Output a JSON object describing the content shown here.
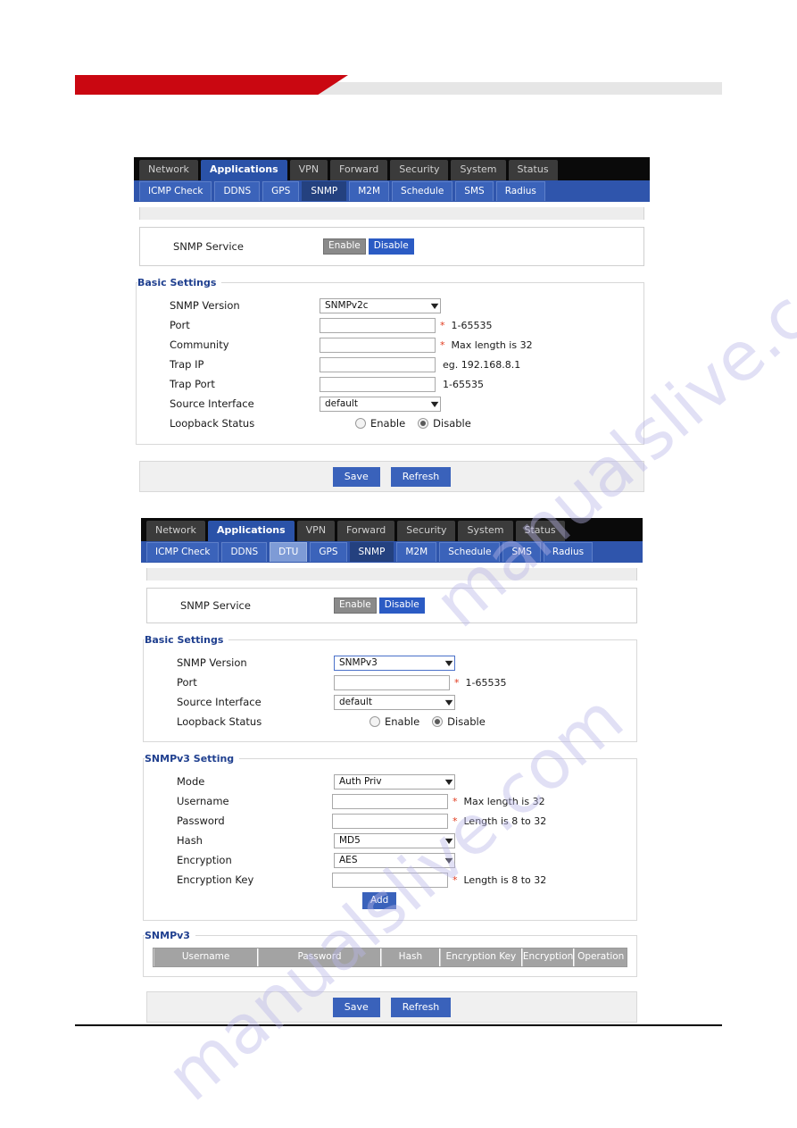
{
  "header": {
    "banner_red_color": "#ca0711",
    "banner_gray_color": "#e6e6e6"
  },
  "watermark": {
    "text_1": "manualslive.com",
    "text_2": "manualslive.com",
    "color": "#b9b6e8"
  },
  "panel1": {
    "main_tabs": [
      {
        "label": "Network",
        "active": false
      },
      {
        "label": "Applications",
        "active": true
      },
      {
        "label": "VPN",
        "active": false
      },
      {
        "label": "Forward",
        "active": false
      },
      {
        "label": "Security",
        "active": false
      },
      {
        "label": "System",
        "active": false
      },
      {
        "label": "Status",
        "active": false
      }
    ],
    "sub_tabs": [
      {
        "label": "ICMP Check",
        "state": "normal"
      },
      {
        "label": "DDNS",
        "state": "normal"
      },
      {
        "label": "GPS",
        "state": "normal"
      },
      {
        "label": "SNMP",
        "state": "active"
      },
      {
        "label": "M2M",
        "state": "normal"
      },
      {
        "label": "Schedule",
        "state": "normal"
      },
      {
        "label": "SMS",
        "state": "normal"
      },
      {
        "label": "Radius",
        "state": "normal"
      }
    ],
    "service": {
      "label": "SNMP Service",
      "enable_label": "Enable",
      "disable_label": "Disable",
      "selected": "Disable"
    },
    "basic_settings": {
      "legend": "Basic Settings",
      "rows": [
        {
          "label": "SNMP Version",
          "type": "select",
          "value": "SNMPv2c",
          "required": false,
          "hint": ""
        },
        {
          "label": "Port",
          "type": "text",
          "value": "",
          "required": true,
          "hint": "1-65535"
        },
        {
          "label": "Community",
          "type": "text",
          "value": "",
          "required": true,
          "hint": "Max length is 32"
        },
        {
          "label": "Trap IP",
          "type": "text",
          "value": "",
          "required": false,
          "hint": "eg. 192.168.8.1"
        },
        {
          "label": "Trap Port",
          "type": "text",
          "value": "",
          "required": false,
          "hint": "1-65535"
        },
        {
          "label": "Source Interface",
          "type": "select",
          "value": "default",
          "required": false,
          "hint": ""
        },
        {
          "label": "Loopback Status",
          "type": "radio",
          "options": [
            "Enable",
            "Disable"
          ],
          "selected": "Disable"
        }
      ]
    },
    "footer": {
      "save_label": "Save",
      "refresh_label": "Refresh"
    }
  },
  "panel2": {
    "main_tabs": [
      {
        "label": "Network",
        "active": false
      },
      {
        "label": "Applications",
        "active": true
      },
      {
        "label": "VPN",
        "active": false
      },
      {
        "label": "Forward",
        "active": false
      },
      {
        "label": "Security",
        "active": false
      },
      {
        "label": "System",
        "active": false
      },
      {
        "label": "Status",
        "active": false
      }
    ],
    "sub_tabs": [
      {
        "label": "ICMP Check",
        "state": "normal"
      },
      {
        "label": "DDNS",
        "state": "normal"
      },
      {
        "label": "DTU",
        "state": "hover"
      },
      {
        "label": "GPS",
        "state": "normal"
      },
      {
        "label": "SNMP",
        "state": "active"
      },
      {
        "label": "M2M",
        "state": "normal"
      },
      {
        "label": "Schedule",
        "state": "normal"
      },
      {
        "label": "SMS",
        "state": "normal"
      },
      {
        "label": "Radius",
        "state": "normal"
      }
    ],
    "service": {
      "label": "SNMP Service",
      "enable_label": "Enable",
      "disable_label": "Disable",
      "selected": "Disable"
    },
    "basic_settings": {
      "legend": "Basic Settings",
      "rows": [
        {
          "label": "SNMP Version",
          "type": "select",
          "value": "SNMPv3",
          "required": false,
          "hint": "",
          "focused": true
        },
        {
          "label": "Port",
          "type": "text",
          "value": "",
          "required": true,
          "hint": "1-65535"
        },
        {
          "label": "Source Interface",
          "type": "select",
          "value": "default",
          "required": false,
          "hint": ""
        },
        {
          "label": "Loopback Status",
          "type": "radio",
          "options": [
            "Enable",
            "Disable"
          ],
          "selected": "Disable"
        }
      ]
    },
    "snmpv3_setting": {
      "legend": "SNMPv3 Setting",
      "rows": [
        {
          "label": "Mode",
          "type": "select",
          "value": "Auth Priv",
          "required": false,
          "hint": ""
        },
        {
          "label": "Username",
          "type": "text",
          "value": "",
          "required": true,
          "hint": "Max length is 32"
        },
        {
          "label": "Password",
          "type": "text",
          "value": "",
          "required": true,
          "hint": "Length is 8 to 32"
        },
        {
          "label": "Hash",
          "type": "select",
          "value": "MD5",
          "required": false,
          "hint": ""
        },
        {
          "label": "Encryption",
          "type": "select",
          "value": "AES",
          "required": false,
          "hint": ""
        },
        {
          "label": "Encryption Key",
          "type": "text",
          "value": "",
          "required": true,
          "hint": "Length is 8 to 32"
        }
      ],
      "add_label": "Add"
    },
    "snmpv3_table": {
      "legend": "SNMPv3",
      "columns": [
        "Username",
        "Password",
        "Hash",
        "Encryption Key",
        "Encryption",
        "Operation"
      ],
      "rows": []
    },
    "footer": {
      "save_label": "Save",
      "refresh_label": "Refresh"
    }
  }
}
